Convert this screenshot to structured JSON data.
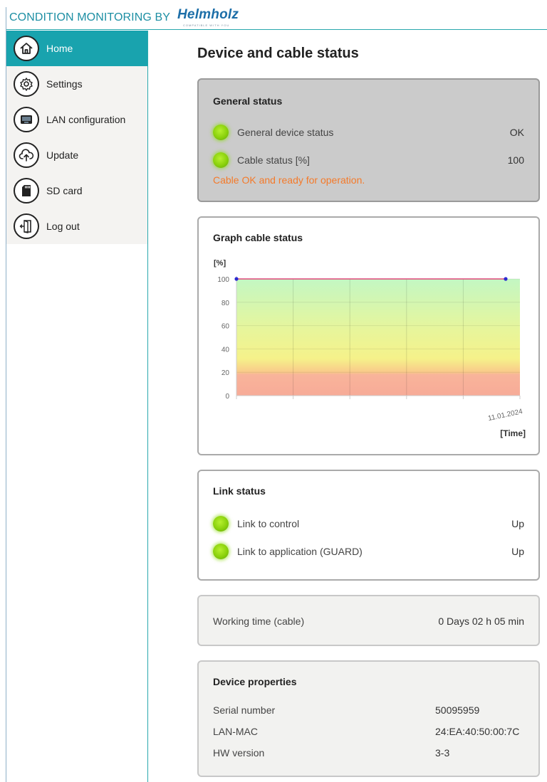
{
  "header": {
    "title": "CONDITION MONITORING BY",
    "brand": "Helmholz",
    "brand_tagline": "COMPATIBLE WITH YOU"
  },
  "sidebar": {
    "items": [
      {
        "label": "Home",
        "icon": "home-icon",
        "active": true
      },
      {
        "label": "Settings",
        "icon": "gear-icon",
        "active": false
      },
      {
        "label": "LAN configuration",
        "icon": "network-icon",
        "active": false
      },
      {
        "label": "Update",
        "icon": "cloud-upload-icon",
        "active": false
      },
      {
        "label": "SD card",
        "icon": "sd-card-icon",
        "active": false
      },
      {
        "label": "Log out",
        "icon": "logout-door-icon",
        "active": false
      }
    ]
  },
  "main": {
    "title": "Device and cable status",
    "general_status": {
      "title": "General status",
      "rows": [
        {
          "label": "General device status",
          "value": "OK"
        },
        {
          "label": "Cable status [%]",
          "value": "100"
        }
      ],
      "message": "Cable OK and ready for operation."
    },
    "graph": {
      "title": "Graph cable status"
    },
    "link_status": {
      "title": "Link status",
      "rows": [
        {
          "label": "Link to control",
          "value": "Up"
        },
        {
          "label": "Link to application (GUARD)",
          "value": "Up"
        }
      ]
    },
    "working_time": {
      "label": "Working time (cable)",
      "value": "0 Days 02 h 05 min"
    },
    "device_properties": {
      "title": "Device properties",
      "rows": [
        {
          "label": "Serial number",
          "value": "50095959"
        },
        {
          "label": "LAN-MAC",
          "value": "24:EA:40:50:00:7C"
        },
        {
          "label": "HW version",
          "value": "3-3"
        }
      ]
    }
  },
  "chart_data": {
    "type": "line",
    "title": "",
    "ylabel": "[%]",
    "xlabel": "[Time]",
    "ylim": [
      0,
      100
    ],
    "yticks": [
      0,
      20,
      40,
      60,
      80,
      100
    ],
    "x": [
      "",
      "11.01.2024"
    ],
    "series": [
      {
        "values": [
          100,
          100
        ]
      }
    ],
    "colors": {
      "line": "#e0457a",
      "points": "#2a2ad0"
    }
  }
}
